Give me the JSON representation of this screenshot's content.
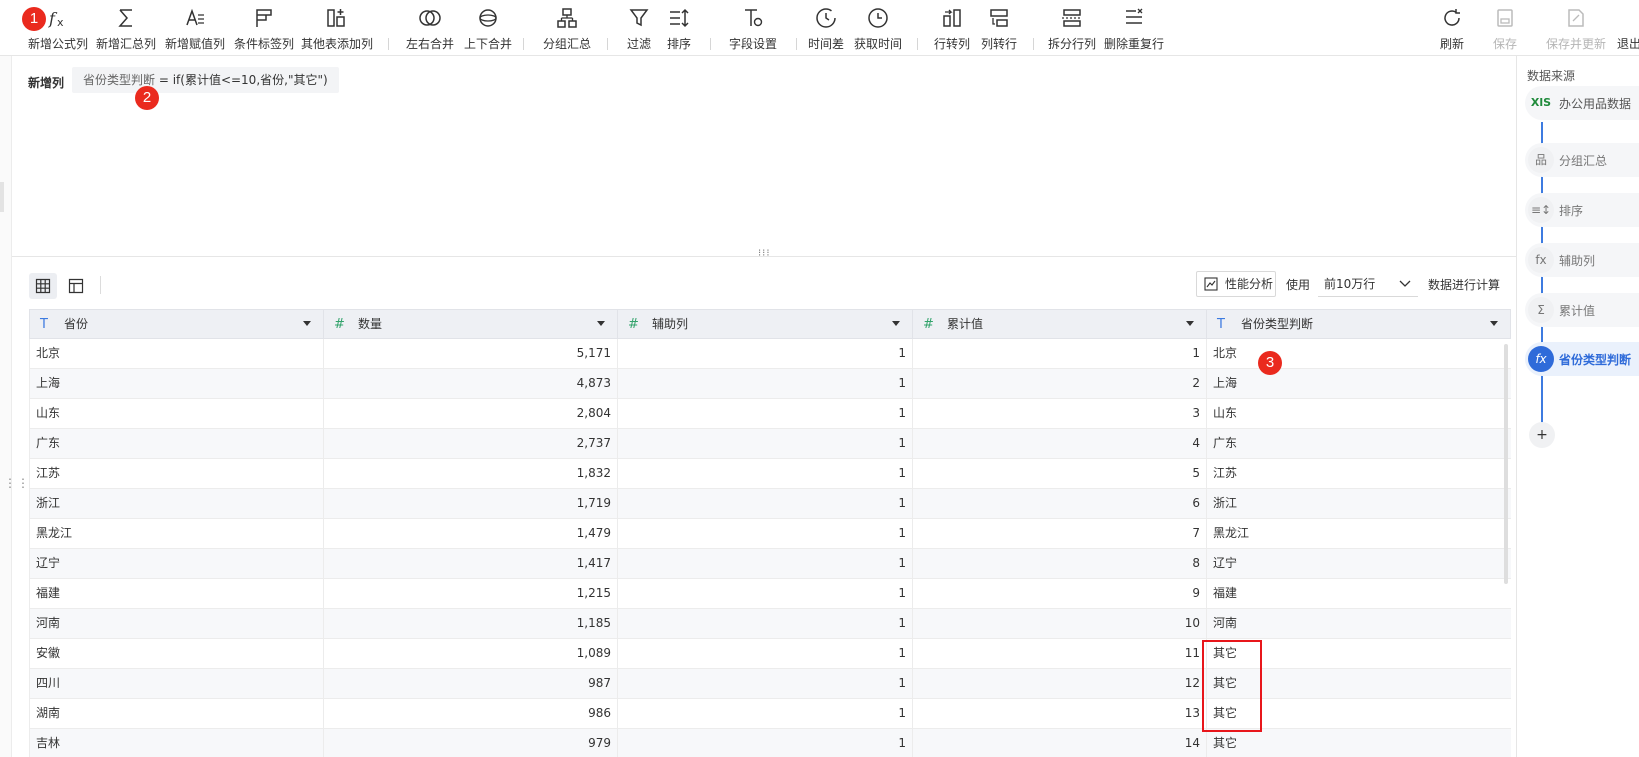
{
  "toolbar": {
    "new_formula_col": "新增公式列",
    "new_summary_col": "新增汇总列",
    "new_value_col": "新增赋值列",
    "cond_label_col": "条件标签列",
    "other_table_col": "其他表添加列",
    "lr_merge": "左右合并",
    "ud_merge": "上下合并",
    "group_summary": "分组汇总",
    "filter": "过滤",
    "sort": "排序",
    "field_settings": "字段设置",
    "time_diff": "时间差",
    "get_time": "获取时间",
    "row_to_col": "行转列",
    "col_to_row": "列转行",
    "split_rows": "拆分行列",
    "dedupe_rows": "删除重复行",
    "refresh": "刷新",
    "save": "保存",
    "save_update": "保存并更新",
    "exit": "退出"
  },
  "markers": [
    "1",
    "2",
    "3"
  ],
  "formula": {
    "title": "新增列",
    "col_name": "省份类型判断",
    "expression": " = if(累计值<=10,省份,\"其它\")"
  },
  "grid": {
    "perf_label": "性能分析",
    "use_label": "使用",
    "rows_option": "前10万行",
    "calc_label": "数据进行计算"
  },
  "table": {
    "columns": [
      {
        "name": "省份",
        "type": "T"
      },
      {
        "name": "数量",
        "type": "#"
      },
      {
        "name": "辅助列",
        "type": "#"
      },
      {
        "name": "累计值",
        "type": "#"
      },
      {
        "name": "省份类型判断",
        "type": "T"
      }
    ],
    "rows": [
      [
        "北京",
        "5,171",
        "1",
        "1",
        "北京"
      ],
      [
        "上海",
        "4,873",
        "1",
        "2",
        "上海"
      ],
      [
        "山东",
        "2,804",
        "1",
        "3",
        "山东"
      ],
      [
        "广东",
        "2,737",
        "1",
        "4",
        "广东"
      ],
      [
        "江苏",
        "1,832",
        "1",
        "5",
        "江苏"
      ],
      [
        "浙江",
        "1,719",
        "1",
        "6",
        "浙江"
      ],
      [
        "黑龙江",
        "1,479",
        "1",
        "7",
        "黑龙江"
      ],
      [
        "辽宁",
        "1,417",
        "1",
        "8",
        "辽宁"
      ],
      [
        "福建",
        "1,215",
        "1",
        "9",
        "福建"
      ],
      [
        "河南",
        "1,185",
        "1",
        "10",
        "河南"
      ],
      [
        "安徽",
        "1,089",
        "1",
        "11",
        "其它"
      ],
      [
        "四川",
        "987",
        "1",
        "12",
        "其它"
      ],
      [
        "湖南",
        "986",
        "1",
        "13",
        "其它"
      ],
      [
        "吉林",
        "979",
        "1",
        "14",
        "其它"
      ]
    ]
  },
  "panel": {
    "title": "数据来源",
    "steps": [
      {
        "icon": "XlS",
        "label": "办公用品数据"
      },
      {
        "icon": "品",
        "label": "分组汇总"
      },
      {
        "icon": "≡↕",
        "label": "排序"
      },
      {
        "icon": "fx",
        "label": "辅助列"
      },
      {
        "icon": "Σ",
        "label": "累计值"
      },
      {
        "icon": "fx",
        "label": "省份类型判断"
      }
    ],
    "add": "+"
  },
  "colors": {
    "accent": "#2f6bd9",
    "marker": "#ea2a1e",
    "highlight": "#e8161b",
    "header_bg": "#eef0f4"
  }
}
